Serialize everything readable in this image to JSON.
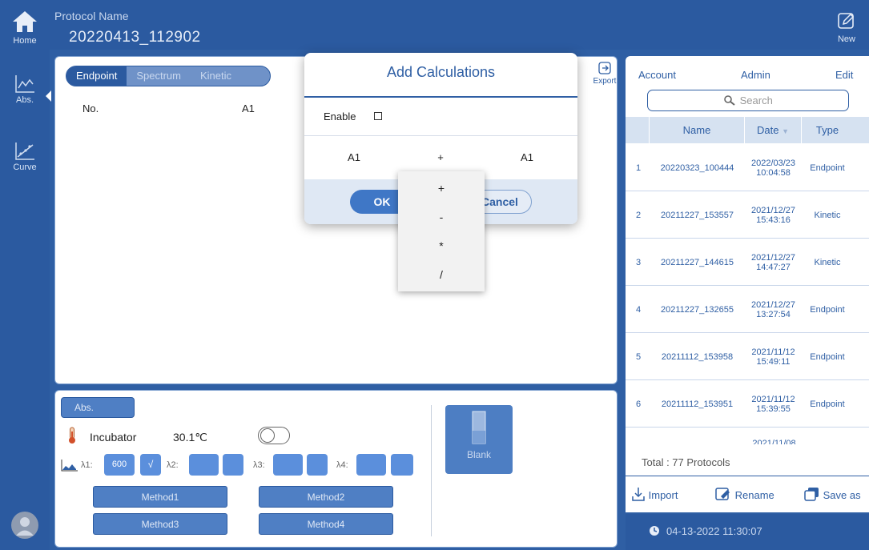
{
  "header": {
    "home_label": "Home",
    "protocol_name_label": "Protocol Name",
    "protocol_name_value": "20220413_112902",
    "new_label": "New"
  },
  "sidebar": {
    "items": [
      {
        "label": "Abs.",
        "icon": "abs-chart-icon"
      },
      {
        "label": "Curve",
        "icon": "curve-icon"
      }
    ]
  },
  "main": {
    "tabs": [
      "Endpoint",
      "Spectrum",
      "Kinetic"
    ],
    "export_label": "Export",
    "columns": [
      "No.",
      "A1"
    ]
  },
  "dialog": {
    "title": "Add Calculations",
    "enable_label": "Enable",
    "operand_left": "A1",
    "operator": "+",
    "operand_right": "A1",
    "ok_label": "OK",
    "cancel_label": "Cancel",
    "operator_options": [
      "+",
      "-",
      "*",
      "/"
    ]
  },
  "bottom": {
    "abs_button": "Abs.",
    "incubator_label": "Incubator",
    "incubator_temp": "30.1℃",
    "lambda1_label": "λ1:",
    "lambda1_value": "600",
    "lambda1_check": "√",
    "lambda2_label": "λ2:",
    "lambda3_label": "λ3:",
    "lambda4_label": "λ4:",
    "methods": [
      "Method1",
      "Method2",
      "Method3",
      "Method4"
    ],
    "blank_label": "Blank"
  },
  "right": {
    "account_label": "Account",
    "account_value": "Admin",
    "edit_label": "Edit",
    "search_placeholder": "Search",
    "columns": [
      "Name",
      "Date",
      "Type"
    ],
    "rows": [
      {
        "no": "1",
        "name": "20220323_100444",
        "date": "2022/03/23",
        "time": "10:04:58",
        "type": "Endpoint"
      },
      {
        "no": "2",
        "name": "20211227_153557",
        "date": "2021/12/27",
        "time": "15:43:16",
        "type": "Kinetic"
      },
      {
        "no": "3",
        "name": "20211227_144615",
        "date": "2021/12/27",
        "time": "14:47:27",
        "type": "Kinetic"
      },
      {
        "no": "4",
        "name": "20211227_132655",
        "date": "2021/12/27",
        "time": "13:27:54",
        "type": "Endpoint"
      },
      {
        "no": "5",
        "name": "20211112_153958",
        "date": "2021/11/12",
        "time": "15:49:11",
        "type": "Endpoint"
      },
      {
        "no": "6",
        "name": "20211112_153951",
        "date": "2021/11/12",
        "time": "15:39:55",
        "type": "Endpoint"
      }
    ],
    "partial_row_date": "2021/11/08",
    "total_label": "Total : 77 Protocols",
    "import_label": "Import",
    "rename_label": "Rename",
    "saveas_label": "Save as",
    "datetime": "04-13-2022 11:30:07"
  }
}
